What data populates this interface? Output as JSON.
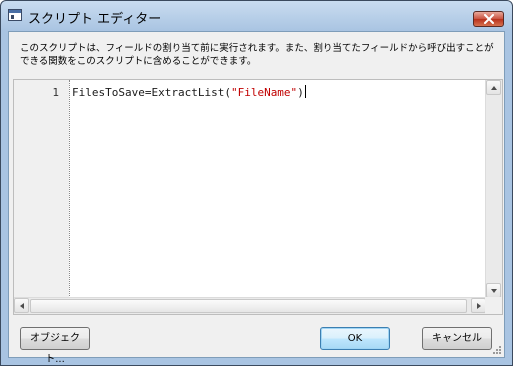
{
  "window": {
    "title": "スクリプト エディター"
  },
  "description": "このスクリプトは、フィールドの割り当て前に実行されます。また、割り当てたフィールドから呼び出すことができる関数をこのスクリプトに含めることができます。",
  "editor": {
    "line_number": "1",
    "code_prefix": "FilesToSave=ExtractList(",
    "code_string": "\"FileName\"",
    "code_suffix": ")"
  },
  "buttons": {
    "object_label": "オブジェクト...",
    "ok_label": "OK",
    "cancel_label": "キャンセル"
  },
  "colors": {
    "string_literal": "#c00000",
    "title_gradient_top": "#c9dcf0",
    "close_button": "#c9513f"
  }
}
